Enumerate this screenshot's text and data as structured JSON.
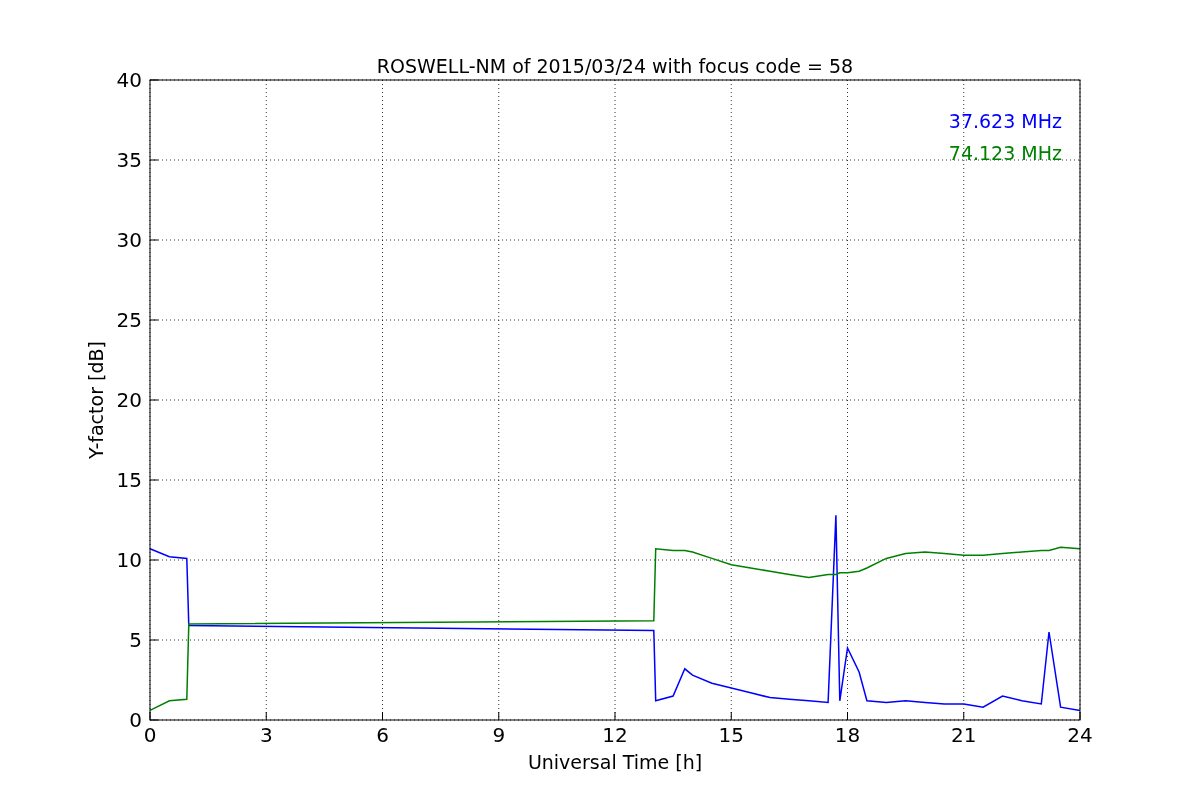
{
  "chart_data": {
    "type": "line",
    "title": "ROSWELL-NM of 2015/03/24 with focus code = 58",
    "xlabel": "Universal Time [h]",
    "ylabel": "Y-factor [dB]",
    "x": [
      0,
      0.5,
      0.95,
      1,
      13,
      13.05,
      13.5,
      13.8,
      14,
      14.5,
      15,
      15.5,
      16,
      16.5,
      17,
      17.5,
      17.7,
      17.8,
      18,
      18.3,
      18.5,
      19,
      19.5,
      20,
      20.5,
      21,
      21.5,
      22,
      22.5,
      23,
      23.2,
      23.5,
      24
    ],
    "series": [
      {
        "name": "37.623 MHz",
        "color": "#0000ff",
        "values": [
          10.7,
          10.2,
          10.1,
          5.9,
          5.6,
          1.2,
          1.5,
          3.2,
          2.8,
          2.3,
          2.0,
          1.7,
          1.4,
          1.3,
          1.2,
          1.1,
          12.8,
          1.2,
          4.5,
          3,
          1.2,
          1.1,
          1.2,
          1.1,
          1.0,
          1.0,
          0.8,
          1.5,
          1.2,
          1.0,
          5.5,
          0.8,
          0.6
        ]
      },
      {
        "name": "74.123 MHz",
        "color": "#008000",
        "values": [
          0.6,
          1.2,
          1.3,
          6.0,
          6.2,
          10.7,
          10.6,
          10.6,
          10.5,
          10.1,
          9.7,
          9.5,
          9.3,
          9.1,
          8.9,
          9.1,
          9.1,
          9.2,
          9.2,
          9.3,
          9.5,
          10.1,
          10.4,
          10.5,
          10.4,
          10.3,
          10.3,
          10.4,
          10.5,
          10.6,
          10.6,
          10.8,
          10.7
        ]
      }
    ],
    "xlim": [
      0,
      24
    ],
    "ylim": [
      0,
      40
    ],
    "xticks": [
      0,
      3,
      6,
      9,
      12,
      15,
      18,
      21,
      24
    ],
    "yticks": [
      0,
      5,
      10,
      15,
      20,
      25,
      30,
      35,
      40
    ],
    "grid": true
  }
}
